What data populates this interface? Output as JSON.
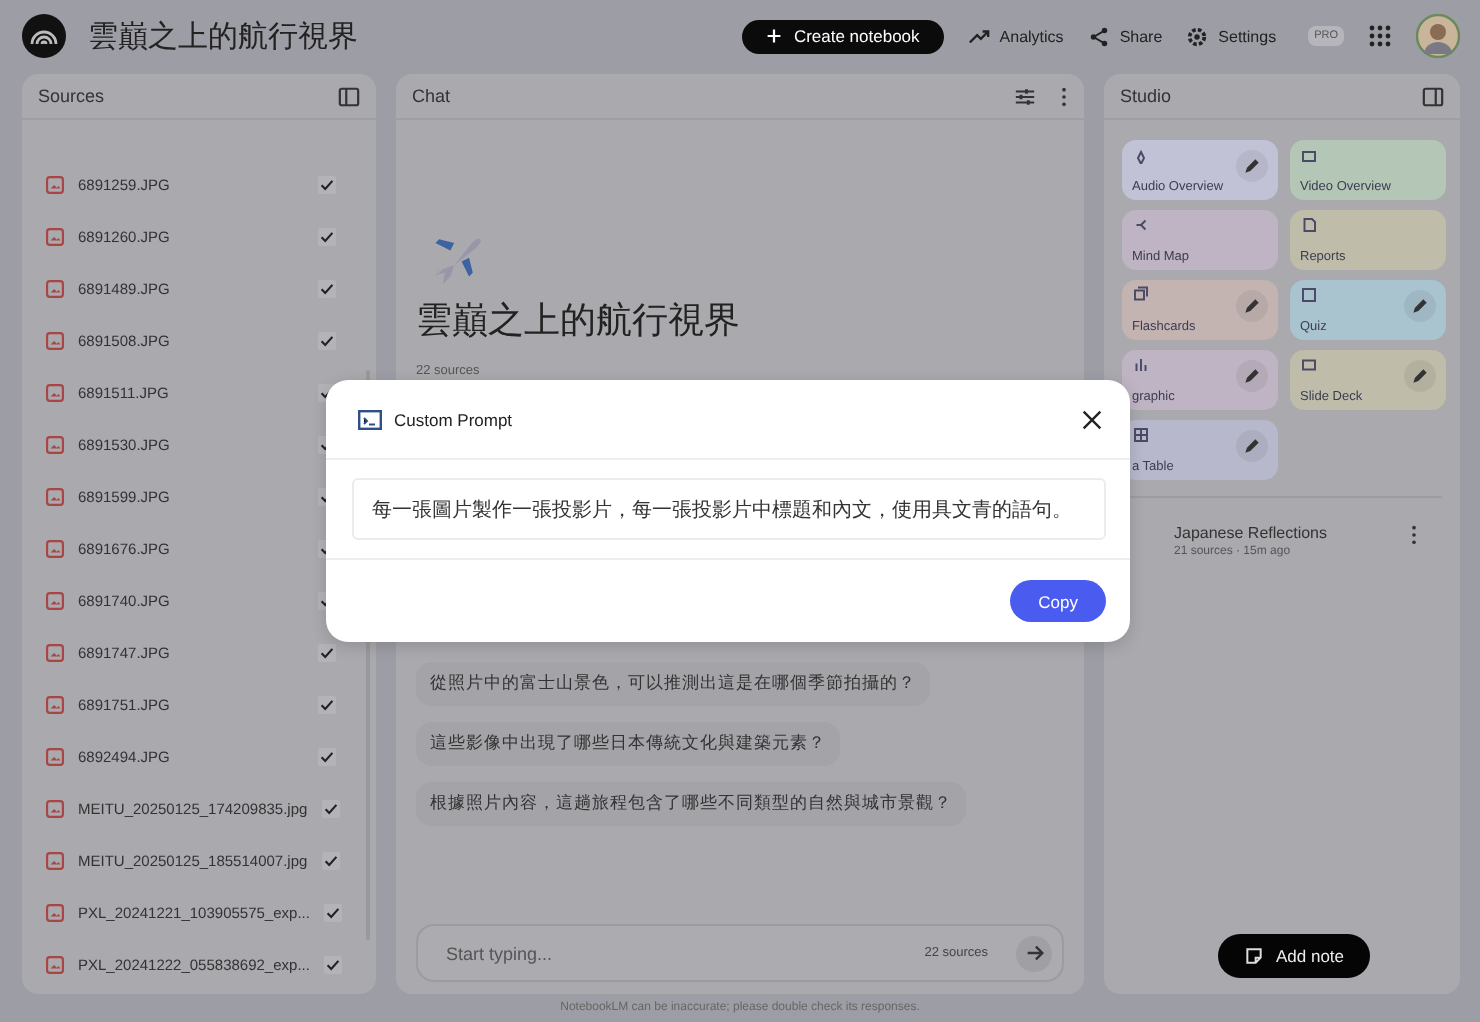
{
  "header": {
    "title": "雲巔之上的航行視界",
    "create_button": "Create notebook",
    "links": [
      {
        "kind": "analytics",
        "label": "Analytics"
      },
      {
        "kind": "share",
        "label": "Share"
      },
      {
        "kind": "settings",
        "label": "Settings"
      }
    ],
    "badge": "PRO"
  },
  "sources": {
    "title": "Sources",
    "items": [
      {
        "name": "6891259.JPG",
        "checked": true
      },
      {
        "name": "6891260.JPG",
        "checked": true
      },
      {
        "name": "6891489.JPG",
        "checked": true
      },
      {
        "name": "6891508.JPG",
        "checked": true
      },
      {
        "name": "6891511.JPG",
        "checked": true
      },
      {
        "name": "6891530.JPG",
        "checked": true
      },
      {
        "name": "6891599.JPG",
        "checked": true
      },
      {
        "name": "6891676.JPG",
        "checked": true
      },
      {
        "name": "6891740.JPG",
        "checked": true
      },
      {
        "name": "6891747.JPG",
        "checked": true
      },
      {
        "name": "6891751.JPG",
        "checked": true
      },
      {
        "name": "6892494.JPG",
        "checked": true
      },
      {
        "name": "MEITU_20250125_174209835.jpg",
        "checked": true
      },
      {
        "name": "MEITU_20250125_185514007.jpg",
        "checked": true
      },
      {
        "name": "PXL_20241221_103905575_exp...",
        "checked": true
      },
      {
        "name": "PXL_20241222_055838692_exp...",
        "checked": true
      }
    ]
  },
  "chat": {
    "title": "Chat",
    "notebook_title": "雲巔之上的航行視界",
    "source_count": "22 sources",
    "suggestions": [
      "從照片中的富士山景色，可以推測出這是在哪個季節拍攝的？",
      "這些影像中出現了哪些日本傳統文化與建築元素？",
      "根據照片內容，這趟旅程包含了哪些不同類型的自然與城市景觀？"
    ],
    "input": {
      "placeholder": "Start typing...",
      "source_count": "22 sources"
    },
    "disclaimer": "NotebookLM can be inaccurate; please double check its responses."
  },
  "studio": {
    "title": "Studio",
    "tiles": [
      {
        "kind": "audio",
        "label": "Audio Overview",
        "color": "#c2c2d6",
        "edit": true
      },
      {
        "kind": "video",
        "label": "Video Overview",
        "color": "#b4c6b6",
        "edit": false
      },
      {
        "kind": "mindmap",
        "label": "Mind Map",
        "color": "#bfb4c3",
        "edit": false
      },
      {
        "kind": "reports",
        "label": "Reports",
        "color": "#bfbcaa",
        "edit": false
      },
      {
        "kind": "flashcards",
        "label": "Flashcards",
        "color": "#c3b4b2",
        "edit": true
      },
      {
        "kind": "quiz",
        "label": "Quiz",
        "color": "#a9c3cf",
        "edit": true
      },
      {
        "kind": "infographic",
        "label": "graphic",
        "color": "#bfb4c3",
        "edit": true
      },
      {
        "kind": "slides",
        "label": "Slide Deck",
        "color": "#bfbcaa",
        "edit": true
      },
      {
        "kind": "table",
        "label": "a Table",
        "color": "#b8b8cc",
        "edit": true
      }
    ],
    "note": {
      "title": "Japanese Reflections",
      "meta": "21 sources · 15m ago"
    },
    "add_note": "Add note"
  },
  "dialog": {
    "title": "Custom Prompt",
    "prompt": "每一張圖片製作一張投影片，每一張投影片中標題和內文，使用具文青的語句。",
    "button": "Copy"
  }
}
